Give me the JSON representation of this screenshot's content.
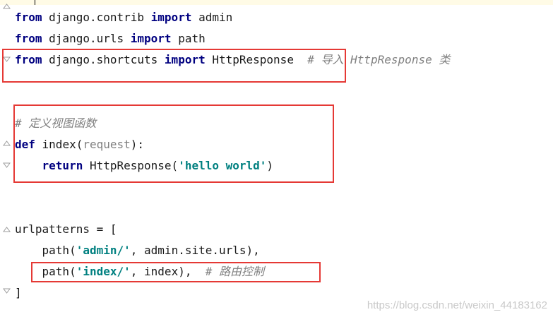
{
  "code": {
    "line1": {
      "kw1": "from",
      "mod": " django.contrib ",
      "kw2": "import",
      "rest": " admin"
    },
    "line2": {
      "kw1": "from",
      "mod": " django.urls ",
      "kw2": "import",
      "rest": " path"
    },
    "line3": {
      "kw1": "from",
      "mod": " django.shortcuts ",
      "kw2": "import",
      "rest": " HttpResponse  ",
      "comment": "# 导入 HttpResponse 类"
    },
    "line5": {
      "comment": "# 定义视图函数"
    },
    "line6": {
      "kw": "def",
      "name": " index(",
      "param": "request",
      "rest": "):"
    },
    "line7": {
      "indent": "    ",
      "kw": "return",
      "call": " HttpResponse(",
      "str": "'hello world'",
      "rest": ")"
    },
    "line10": {
      "text": "urlpatterns = ["
    },
    "line11": {
      "pre": "    path(",
      "str": "'admin/'",
      "rest": ", admin.site.urls),"
    },
    "line12": {
      "pre": "    path(",
      "str": "'index/'",
      "rest": ", index),  ",
      "comment": "# 路由控制"
    },
    "line13": {
      "text": "]"
    }
  },
  "watermark": "https://blog.csdn.net/weixin_44183162",
  "colors": {
    "keyword": "#000080",
    "string": "#008080",
    "comment": "#808080",
    "highlight_box": "#e53935"
  }
}
